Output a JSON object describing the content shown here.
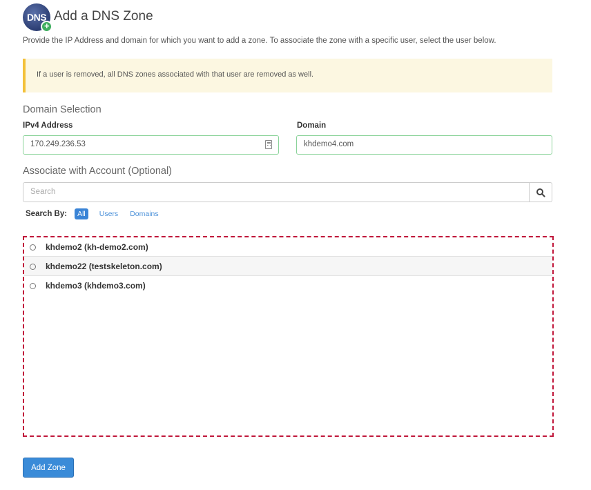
{
  "header": {
    "logo_text": "DNS",
    "title": "Add a DNS Zone"
  },
  "intro": "Provide the IP Address and domain for which you want to add a zone. To associate the zone with a specific user, select the user below.",
  "alert": {
    "text": "If a user is removed, all DNS zones associated with that user are removed as well.",
    "color": "#f3c13a"
  },
  "domain_selection": {
    "section_label": "Domain Selection",
    "ipv4_label": "IPv4 Address",
    "ipv4_value": "170.249.236.53",
    "domain_label": "Domain",
    "domain_value": "khdemo4.com"
  },
  "associate": {
    "section_label": "Associate with Account (Optional)",
    "search_placeholder": "Search",
    "search_by_label": "Search By:",
    "search_by_options": [
      "All",
      "Users",
      "Domains"
    ],
    "selected_option": "All",
    "accounts": [
      {
        "label": "khdemo2 (kh-demo2.com)"
      },
      {
        "label": "khdemo22 (testskeleton.com)"
      },
      {
        "label": "khdemo3 (khdemo3.com)"
      }
    ]
  },
  "submit_label": "Add Zone",
  "colors": {
    "accent": "#3a84d6",
    "valid_border": "#8bd39a",
    "highlight_box": "#c0163a"
  }
}
